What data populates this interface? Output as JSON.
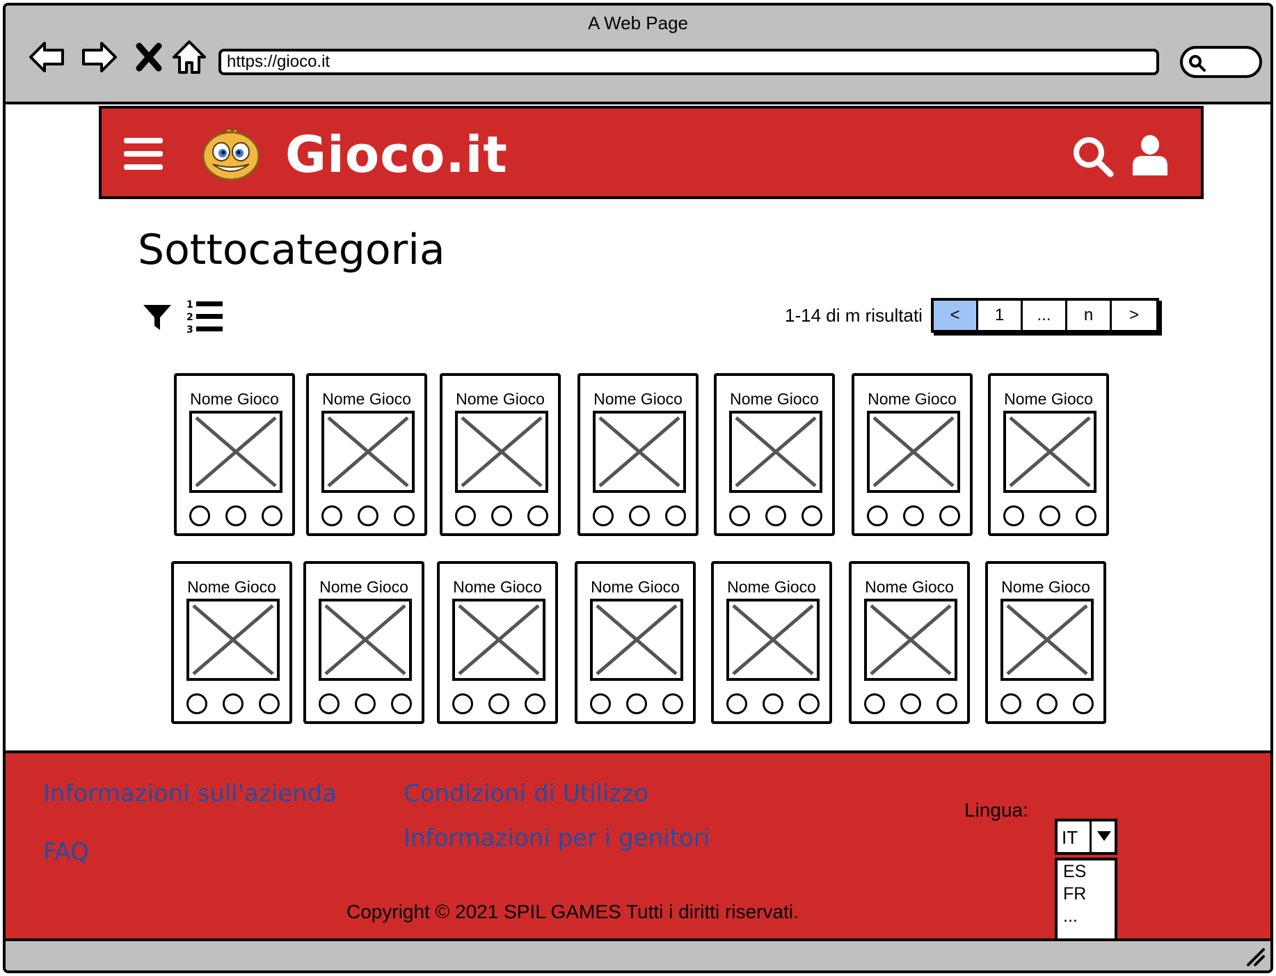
{
  "window": {
    "title": "A Web Page"
  },
  "browser": {
    "url": "https://gioco.it"
  },
  "header": {
    "brand": "Gioco.it"
  },
  "main": {
    "title": "Sottocategoria",
    "results": "1-14 di m risultati",
    "pagination": [
      "<",
      "1",
      "...",
      "n",
      ">"
    ],
    "active_page_index": 0
  },
  "cards": [
    {
      "name": "Nome Gioco"
    },
    {
      "name": "Nome Gioco"
    },
    {
      "name": "Nome Gioco"
    },
    {
      "name": "Nome Gioco"
    },
    {
      "name": "Nome Gioco"
    },
    {
      "name": "Nome Gioco"
    },
    {
      "name": "Nome Gioco"
    },
    {
      "name": "Nome Gioco"
    },
    {
      "name": "Nome Gioco"
    },
    {
      "name": "Nome Gioco"
    },
    {
      "name": "Nome Gioco"
    },
    {
      "name": "Nome Gioco"
    },
    {
      "name": "Nome Gioco"
    },
    {
      "name": "Nome Gioco"
    }
  ],
  "footer": {
    "links": [
      "Informazioni sull'azienda",
      "FAQ",
      "Condizioni di Utilizzo",
      "Informazioni per i genitori"
    ],
    "language_label": "Lingua:",
    "language_selected": "IT",
    "language_options": [
      "ES",
      "FR",
      "..."
    ],
    "copyright": "Copyright © 2021 SPIL GAMES Tutti i diritti riservati."
  },
  "colors": {
    "header_bg": "#cf2a2a",
    "footer_bg": "#cf2a2a",
    "link": "#1f4fa3",
    "active_page": "#9ec3f5",
    "chrome": "#c0c0c0"
  }
}
